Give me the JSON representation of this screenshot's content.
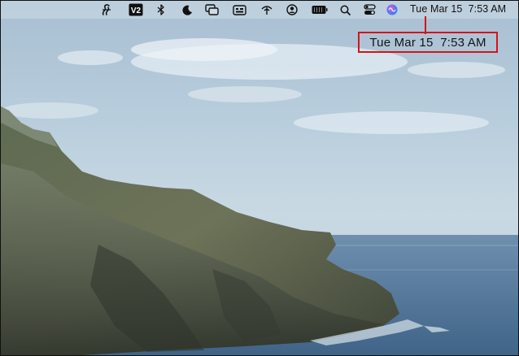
{
  "menu_bar": {
    "status_icons": [
      "script-editor-icon",
      "v2-app-icon",
      "bluetooth-icon",
      "focus-moon-icon",
      "screen-mirroring-icon",
      "keyboard-viewer-icon",
      "wifi-antenna-icon",
      "user-account-icon",
      "battery-icon",
      "spotlight-search-icon",
      "control-center-icon",
      "siri-icon"
    ],
    "v2_label": "V2",
    "clock_text": "Tue Mar 15  7:53 AM"
  },
  "highlight": {
    "enlarged_clock_text": "Tue Mar 15  7:53 AM",
    "color": "#d3141b"
  }
}
